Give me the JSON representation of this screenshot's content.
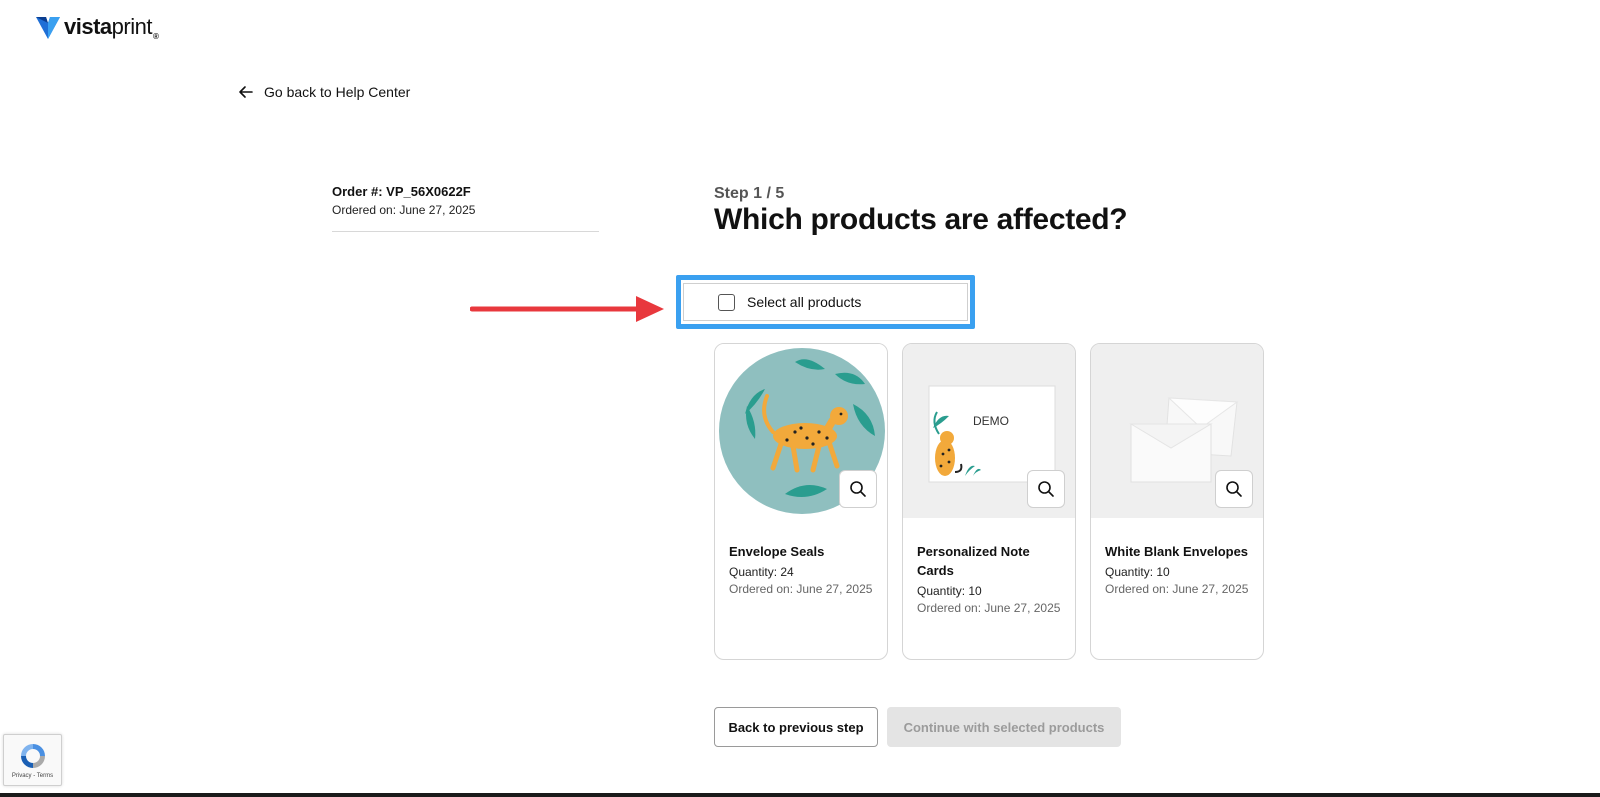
{
  "header": {
    "logo_bold": "vista",
    "logo_thin": "print",
    "logo_reg": "®"
  },
  "nav": {
    "back_link": "Go back to Help Center"
  },
  "order": {
    "number": "Order #: VP_56X0622F",
    "date": "Ordered on: June 27, 2025"
  },
  "step": {
    "label": "Step 1 / 5",
    "title": "Which products are affected?"
  },
  "select_all": {
    "label": "Select all products",
    "checked": false
  },
  "products": [
    {
      "name": "Envelope Seals",
      "quantity": "Quantity: 24",
      "date": "Ordered on: June 27, 2025"
    },
    {
      "name": "Personalized Note Cards",
      "quantity": "Quantity: 10",
      "date": "Ordered on: June 27, 2025",
      "demo_text": "DEMO"
    },
    {
      "name": "White Blank Envelopes",
      "quantity": "Quantity: 10",
      "date": "Ordered on: June 27, 2025"
    }
  ],
  "actions": {
    "back": "Back to previous step",
    "continue": "Continue with selected products"
  },
  "recaptcha": {
    "text": "Privacy - Terms"
  },
  "colors": {
    "highlight": "#3aa0f0",
    "arrow": "#e8383d",
    "seal_bg": "#8fbfbf",
    "leaf": "#2a9d8f",
    "cheetah": "#f2a93b"
  }
}
